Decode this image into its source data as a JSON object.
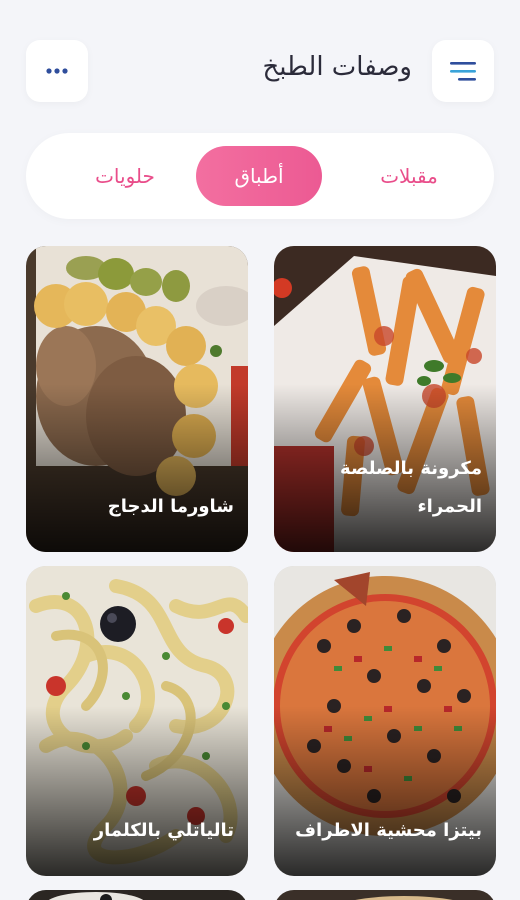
{
  "header": {
    "title": "وصفات الطبخ",
    "menu_icon": "hamburger-menu-icon",
    "more_icon": "more-dots-icon",
    "accent": "#3a7bd5"
  },
  "tabs": [
    {
      "label": "حلويات",
      "active": false
    },
    {
      "label": "أطباق",
      "active": true
    },
    {
      "label": "مقبلات",
      "active": false
    }
  ],
  "colors": {
    "active_tab": "#ee5f95",
    "tab_text": "#e94d8a",
    "background": "#f4f5f9"
  },
  "recipes": [
    {
      "name": "شاورما الدجاج"
    },
    {
      "name": "مكرونة بالصلصة الحمراء"
    },
    {
      "name": "تالياتلي بالكلمار"
    },
    {
      "name": "بيتزا محشية الاطراف"
    }
  ]
}
